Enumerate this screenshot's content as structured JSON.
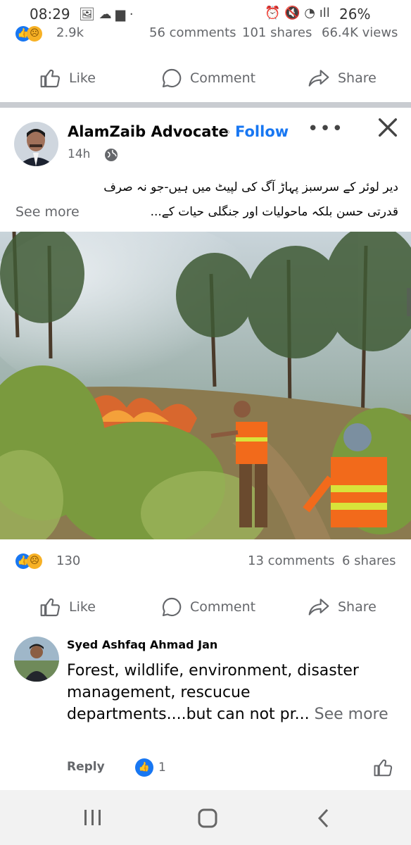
{
  "status_bar": {
    "time": "08:29",
    "battery": "26%"
  },
  "prev_post": {
    "reactions_count": "2.9k",
    "comments": "56 comments",
    "shares": "101 shares",
    "views": "66.4K views",
    "actions": {
      "like": "Like",
      "comment": "Comment",
      "share": "Share"
    }
  },
  "post": {
    "author": "AlamZaib Advocate",
    "follow_label": "Follow",
    "time": "14h",
    "text_line1": "دیر لوئر کے سرسبز پہاڑ آگ کی لپیٹ میں ہیں-جو نہ صرف",
    "text_line2": "قدرتی حسن بلکہ ماحولیات اور جنگلی حیات کے...",
    "see_more": "See more",
    "reactions_count": "130",
    "comments": "13 comments",
    "shares": "6 shares",
    "actions": {
      "like": "Like",
      "comment": "Comment",
      "share": "Share"
    }
  },
  "comment": {
    "author": "Syed Ashfaq Ahmad Jan",
    "text": "Forest, wildlife, environment, disaster management, rescucue departments....but can not pr... ",
    "see_more": "See more",
    "reply_label": "Reply",
    "like_count": "1"
  },
  "colors": {
    "accent": "#1877f2",
    "muted": "#65676b",
    "divider": "#c9ccd1"
  }
}
